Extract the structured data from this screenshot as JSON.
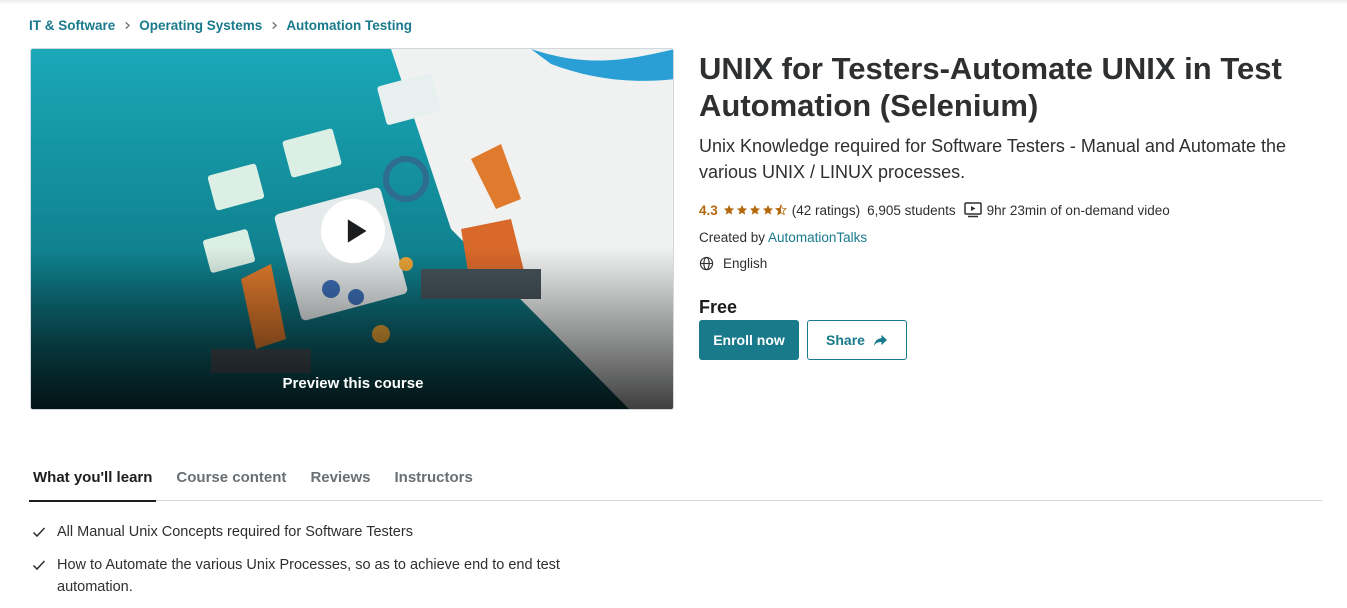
{
  "breadcrumb": [
    {
      "label": "IT & Software"
    },
    {
      "label": "Operating Systems"
    },
    {
      "label": "Automation Testing"
    }
  ],
  "preview": {
    "label": "Preview this course",
    "play_icon": "play-icon"
  },
  "course": {
    "title": "UNIX for Testers-Automate UNIX in Test Automation (Selenium)",
    "subtitle": "Unix Knowledge required for Software Testers - Manual and Automate the various UNIX / LINUX processes.",
    "rating": "4.3",
    "stars": 4.3,
    "ratings_count": "(42 ratings)",
    "students": "6,905 students",
    "video_length": "9hr 23min of on-demand video",
    "created_prefix": "Created by ",
    "instructor": "AutomationTalks",
    "language": "English",
    "price": "Free"
  },
  "actions": {
    "enroll_label": "Enroll now",
    "share_label": "Share"
  },
  "tabs": [
    {
      "label": "What you'll learn",
      "active": true
    },
    {
      "label": "Course content",
      "active": false
    },
    {
      "label": "Reviews",
      "active": false
    },
    {
      "label": "Instructors",
      "active": false
    }
  ],
  "learn_items": [
    "All Manual Unix Concepts required for Software Testers",
    "How to Automate the various Unix Processes, so as to achieve end to end test automation."
  ],
  "colors": {
    "link": "#197a8c",
    "star": "#b4690e",
    "enroll_bg": "#197a8c",
    "text": "#2d2f31"
  }
}
